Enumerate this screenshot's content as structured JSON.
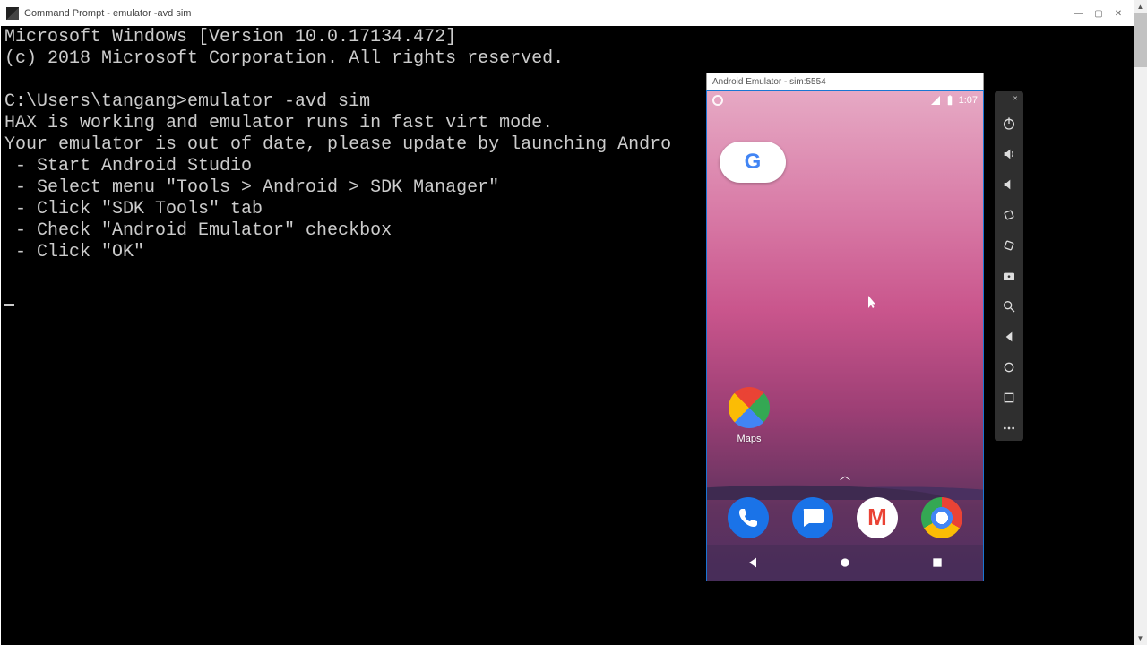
{
  "cmd": {
    "title": "Command Prompt - emulator  -avd sim",
    "lines": [
      "Microsoft Windows [Version 10.0.17134.472]",
      "(c) 2018 Microsoft Corporation. All rights reserved.",
      "",
      "C:\\Users\\tangang>emulator -avd sim",
      "HAX is working and emulator runs in fast virt mode.",
      "Your emulator is out of date, please update by launching Andro",
      " - Start Android Studio",
      " - Select menu \"Tools > Android > SDK Manager\"",
      " - Click \"SDK Tools\" tab",
      " - Check \"Android Emulator\" checkbox",
      " - Click \"OK\"",
      ""
    ],
    "min": "—",
    "max": "▢",
    "close": "✕"
  },
  "emulator": {
    "title": "Android Emulator - sim:5554",
    "clock": "1:07",
    "maps_label": "Maps",
    "drawer_hint": "︿",
    "dock": {
      "phone": "phone",
      "messages": "messages",
      "gmail": "gmail",
      "chrome": "chrome"
    },
    "tools": {
      "minimize": "minimize",
      "close": "close",
      "power": "power",
      "vol_up": "volume-up",
      "vol_down": "volume-down",
      "rotate_left": "rotate-left",
      "rotate_right": "rotate-right",
      "screenshot": "screenshot",
      "zoom": "zoom",
      "back": "back",
      "home": "home",
      "overview": "overview",
      "more": "more"
    }
  }
}
